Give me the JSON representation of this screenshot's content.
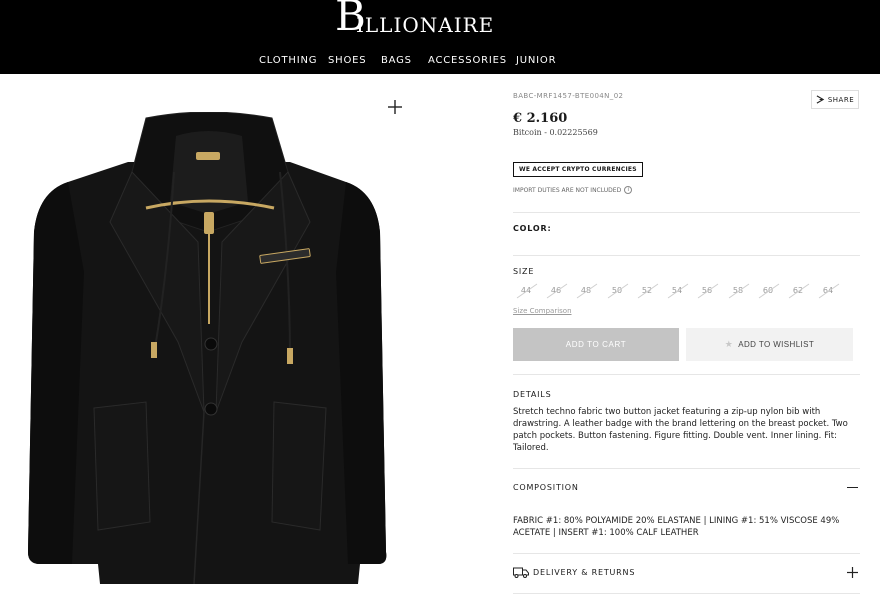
{
  "brand": {
    "logo_initial": "B",
    "logo_rest": "ILLIONAIRE"
  },
  "nav": {
    "items": [
      {
        "label": "CLOTHING"
      },
      {
        "label": "SHOES"
      },
      {
        "label": "BAGS"
      },
      {
        "label": "ACCESSORIES"
      },
      {
        "label": "JUNIOR"
      }
    ]
  },
  "product": {
    "sku": "BABC-MRF1457-BTE004N_02",
    "share_label": "SHARE",
    "price": "€ 2.160",
    "bitcoin": "Bitcoin - 0.02225569",
    "crypto_badge": "WE ACCEPT CRYPTO CURRENCIES",
    "duties_note": "IMPORT DUTIES ARE NOT INCLUDED",
    "color_label": "COLOR:",
    "size_label": "SIZE",
    "sizes": [
      "44",
      "46",
      "48",
      "50",
      "52",
      "54",
      "56",
      "58",
      "60",
      "62",
      "64"
    ],
    "size_comparison": "Size Comparison",
    "add_to_cart": "ADD TO CART",
    "add_to_wishlist": "ADD TO WISHLIST",
    "details_label": "DETAILS",
    "details_text": "Stretch techno fabric two button jacket featuring a zip-up nylon bib with drawstring. A leather badge with the brand lettering on the breast pocket. Two patch pockets. Button fastening. Figure fitting. Double vent. Inner lining. Fit: Tailored.",
    "composition_label": "COMPOSITION",
    "composition_text": "FABRIC #1: 80% POLYAMIDE 20% ELASTANE | LINING #1: 51% VISCOSE 49% ACETATE | INSERT #1: 100% CALF LEATHER",
    "delivery_label": "DELIVERY & RETURNS"
  },
  "colors": {
    "header_bg": "#000000",
    "cart_disabled": "#c4c4c4",
    "wishlist_bg": "#f2f2f2",
    "jacket": "#141414",
    "zipper_gold": "#c8a862"
  }
}
